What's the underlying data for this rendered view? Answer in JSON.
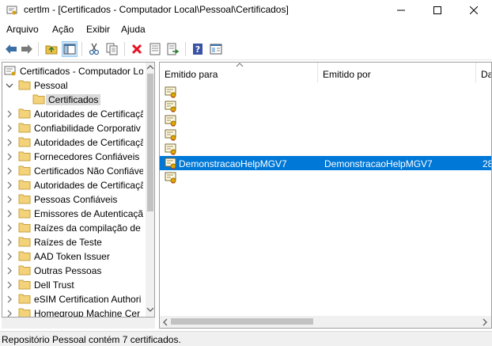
{
  "window": {
    "title": "certlm - [Certificados - Computador Local\\Pessoal\\Certificados]"
  },
  "menu": {
    "items": [
      "Arquivo",
      "Ação",
      "Exibir",
      "Ajuda"
    ]
  },
  "toolbar": {
    "icons": [
      "back-arrow-icon",
      "forward-arrow-icon",
      "up-folder-icon",
      "show-hide-tree-icon",
      "cut-icon",
      "copy-icon",
      "delete-icon",
      "properties-icon",
      "export-list-icon",
      "help-icon",
      "view-icon"
    ]
  },
  "tree": {
    "items": [
      {
        "label": "Certificados - Computador Lo",
        "level": 0,
        "expander": "none",
        "icon": "certificate-store-icon"
      },
      {
        "label": "Pessoal",
        "level": 1,
        "expander": "expanded",
        "icon": "folder-icon"
      },
      {
        "label": "Certificados",
        "level": 2,
        "expander": "none",
        "icon": "folder-icon",
        "selected": true
      },
      {
        "label": "Autoridades de Certificaçã",
        "level": 1,
        "expander": "collapsed",
        "icon": "folder-icon"
      },
      {
        "label": "Confiabilidade Corporativ",
        "level": 1,
        "expander": "collapsed",
        "icon": "folder-icon"
      },
      {
        "label": "Autoridades de Certificaçã",
        "level": 1,
        "expander": "collapsed",
        "icon": "folder-icon"
      },
      {
        "label": "Fornecedores Confiáveis",
        "level": 1,
        "expander": "collapsed",
        "icon": "folder-icon"
      },
      {
        "label": "Certificados Não Confiáve",
        "level": 1,
        "expander": "collapsed",
        "icon": "folder-icon"
      },
      {
        "label": "Autoridades de Certificaçã",
        "level": 1,
        "expander": "collapsed",
        "icon": "folder-icon"
      },
      {
        "label": "Pessoas Confiáveis",
        "level": 1,
        "expander": "collapsed",
        "icon": "folder-icon"
      },
      {
        "label": "Emissores de Autenticaçã",
        "level": 1,
        "expander": "collapsed",
        "icon": "folder-icon"
      },
      {
        "label": "Raízes da compilação de p",
        "level": 1,
        "expander": "collapsed",
        "icon": "folder-icon"
      },
      {
        "label": "Raízes de Teste",
        "level": 1,
        "expander": "collapsed",
        "icon": "folder-icon"
      },
      {
        "label": "AAD Token Issuer",
        "level": 1,
        "expander": "collapsed",
        "icon": "folder-icon"
      },
      {
        "label": "Outras Pessoas",
        "level": 1,
        "expander": "collapsed",
        "icon": "folder-icon"
      },
      {
        "label": "Dell Trust",
        "level": 1,
        "expander": "collapsed",
        "icon": "folder-icon"
      },
      {
        "label": "eSIM Certification Authori",
        "level": 1,
        "expander": "collapsed",
        "icon": "folder-icon"
      },
      {
        "label": "Homegroup Machine Cer",
        "level": 1,
        "expander": "collapsed",
        "icon": "folder-icon"
      }
    ]
  },
  "list": {
    "columns": [
      "Emitido para",
      "Emitido por",
      "Da"
    ],
    "rows": [
      {
        "issued_to": "",
        "issued_by": "",
        "date": "",
        "icon": "certificate-icon"
      },
      {
        "issued_to": "",
        "issued_by": "",
        "date": "",
        "icon": "certificate-icon"
      },
      {
        "issued_to": "",
        "issued_by": "",
        "date": "",
        "icon": "certificate-icon"
      },
      {
        "issued_to": "",
        "issued_by": "",
        "date": "",
        "icon": "certificate-icon"
      },
      {
        "issued_to": "",
        "issued_by": "",
        "date": "",
        "icon": "certificate-icon"
      },
      {
        "issued_to": "DemonstracaoHelpMGV7",
        "issued_by": "DemonstracaoHelpMGV7",
        "date": "28",
        "icon": "certificate-icon",
        "selected": true
      },
      {
        "issued_to": "",
        "issued_by": "",
        "date": "",
        "icon": "certificate-icon"
      }
    ]
  },
  "status": {
    "text": "Repositório Pessoal contém 7 certificados."
  },
  "colors": {
    "selection": "#0078d7",
    "tree_selection": "#d9d9d9",
    "delete_red": "#e81123"
  }
}
